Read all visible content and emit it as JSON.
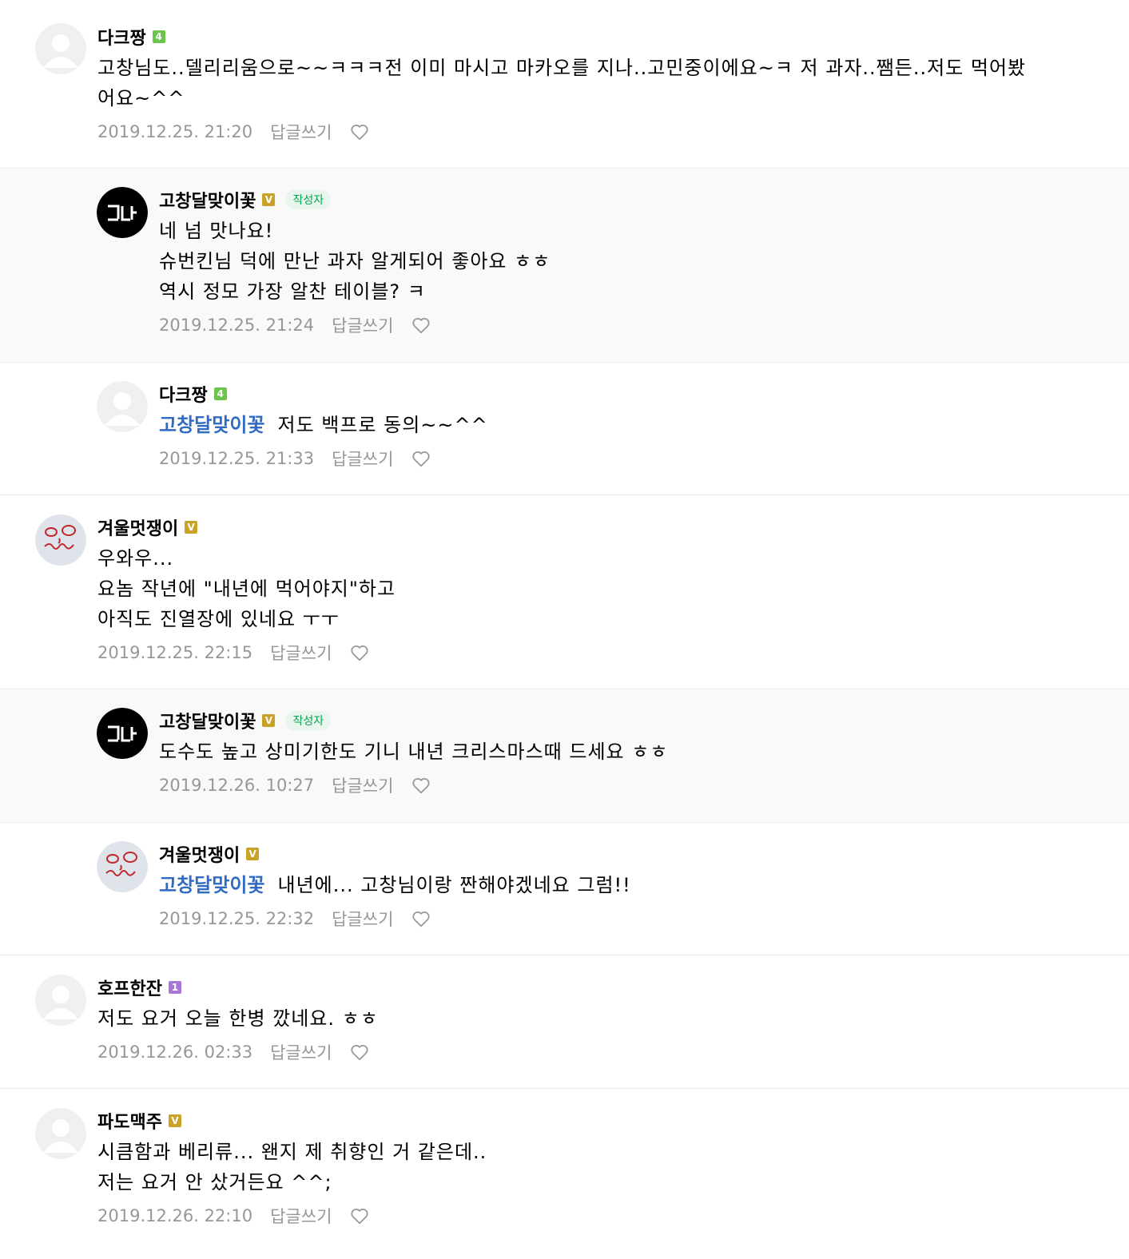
{
  "reply_label": "답글쓰기",
  "author_badge": "작성자",
  "comments": [
    {
      "nickname": "다크짱",
      "level": "4",
      "text": "고창님도..델리리움으로~~ㅋㅋㅋ전 이미 마시고 마카오를 지나..고민중이에요~ㅋ 저 과자..쨈든..저도 먹어봤\n어요~^^",
      "date": "2019.12.25. 21:20"
    },
    {
      "nickname": "고창달맞이꽃",
      "level": "V",
      "text": "네 넘 맛나요!\n슈번킨님 덕에 만난 과자 알게되어 좋아요 ㅎㅎ\n역시 정모 가장 알찬 테이블? ㅋ",
      "date": "2019.12.25. 21:24"
    },
    {
      "nickname": "다크짱",
      "level": "4",
      "mention": "고창달맞이꽃",
      "text": "저도 백프로 동의~~^^",
      "date": "2019.12.25. 21:33"
    },
    {
      "nickname": "겨울멋쟁이",
      "level": "V",
      "text": "우와우...\n요놈 작년에 \"내년에 먹어야지\"하고\n아직도 진열장에 있네요 ㅜㅜ",
      "date": "2019.12.25. 22:15"
    },
    {
      "nickname": "고창달맞이꽃",
      "level": "V",
      "text": "도수도 높고 상미기한도 기니 내년 크리스마스때 드세요 ㅎㅎ",
      "date": "2019.12.26. 10:27"
    },
    {
      "nickname": "겨울멋쟁이",
      "level": "V",
      "mention": "고창달맞이꽃",
      "text": "내년에... 고창님이랑 짠해야겠네요 그럼!!",
      "date": "2019.12.25. 22:32"
    },
    {
      "nickname": "호프한잔",
      "level": "1",
      "text": "저도 요거 오늘 한병 깠네요. ㅎㅎ",
      "date": "2019.12.26. 02:33"
    },
    {
      "nickname": "파도맥주",
      "level": "V",
      "text": "시큼함과 베리류... 왠지 제 취향인 거 같은데..\n저는 요거 안 샀거든요 ^^;",
      "date": "2019.12.26. 22:10"
    }
  ],
  "colors": {
    "level_green": "#6bc44b",
    "level_gold": "#c9a227",
    "level_purple": "#a878d8",
    "author_green": "#03a74f",
    "mention_blue": "#2f6bc4",
    "meta_gray": "#979797",
    "reply_bg": "#f9f9f9"
  }
}
